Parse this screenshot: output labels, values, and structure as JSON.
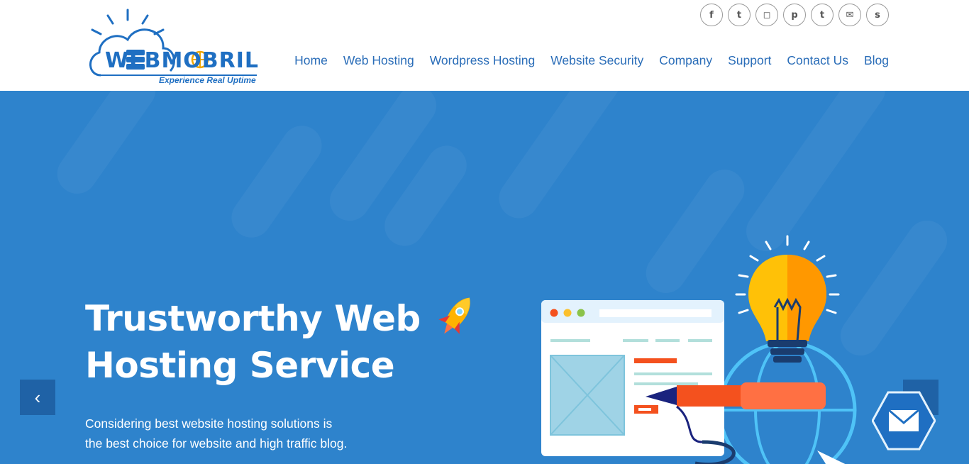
{
  "logo": {
    "word": "WEBMOBRIL",
    "tagline": "Experience Real Uptime"
  },
  "social": [
    {
      "icon": "facebook-icon",
      "glyph": "f"
    },
    {
      "icon": "twitter-icon",
      "glyph": "t"
    },
    {
      "icon": "instagram-icon",
      "glyph": "◻"
    },
    {
      "icon": "pinterest-icon",
      "glyph": "p"
    },
    {
      "icon": "tumblr-icon",
      "glyph": "t"
    },
    {
      "icon": "email-icon",
      "glyph": "✉"
    },
    {
      "icon": "skype-icon",
      "glyph": "s"
    }
  ],
  "nav": [
    "Home",
    "Web Hosting",
    "Wordpress Hosting",
    "Website Security",
    "Company",
    "Support",
    "Contact Us",
    "Blog"
  ],
  "hero": {
    "title_line1": "Trustworthy Web",
    "title_line2": "Hosting Service",
    "subtitle_line1": "Considering best website hosting solutions is",
    "subtitle_line2": "the best choice for website and high traffic blog."
  },
  "colors": {
    "brand": "#1f6fc2",
    "hero_bg": "#2e83cc",
    "nav_link": "#2a6db8",
    "bulb": "#ffc107",
    "pen": "#f4511e"
  },
  "controls": {
    "prev": "‹",
    "next": "›"
  }
}
